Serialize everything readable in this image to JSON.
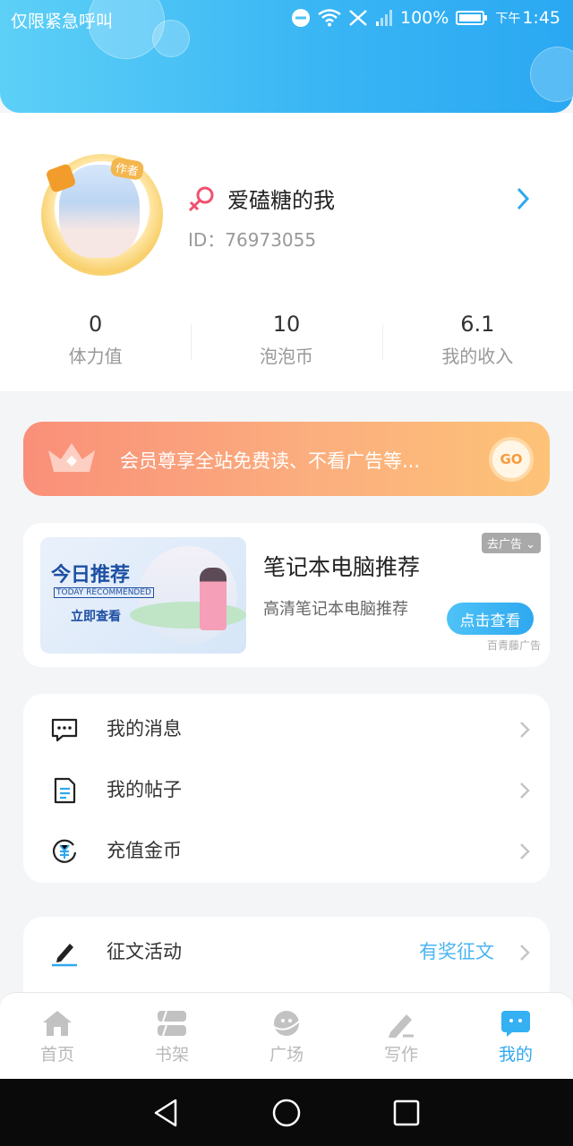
{
  "status_bar": {
    "left_text": "仅限紧急呼叫",
    "battery": "100%",
    "ampm": "下午",
    "time": "1:45"
  },
  "profile": {
    "avatar_tag": "作者",
    "username": "爱磕糖的我",
    "id_label": "ID：76973055",
    "stats": [
      {
        "value": "0",
        "label": "体力值"
      },
      {
        "value": "10",
        "label": "泡泡币"
      },
      {
        "value": "6.1",
        "label": "我的收入"
      }
    ]
  },
  "vip_banner": {
    "text": "会员尊享全站免费读、不看广告等...",
    "go": "GO"
  },
  "ad": {
    "image_title": "今日推荐",
    "image_subtitle": "TODAY RECOMMENDED",
    "image_button": "立即查看",
    "title": "笔记本电脑推荐",
    "description": "高清笔记本电脑推荐",
    "close_label": "去广告",
    "cta": "点击查看",
    "source": "百青藤广告"
  },
  "menu": {
    "items": [
      {
        "label": "我的消息",
        "icon": "chat-icon"
      },
      {
        "label": "我的帖子",
        "icon": "document-icon"
      },
      {
        "label": "充值金币",
        "icon": "coin-icon"
      }
    ],
    "contest": {
      "label": "征文活动",
      "extra": "有奖征文",
      "icon": "pen-icon"
    }
  },
  "tabs": [
    {
      "label": "首页",
      "icon": "home-icon",
      "active": false
    },
    {
      "label": "书架",
      "icon": "bookshelf-icon",
      "active": false
    },
    {
      "label": "广场",
      "icon": "planet-icon",
      "active": false
    },
    {
      "label": "写作",
      "icon": "pen-icon",
      "active": false
    },
    {
      "label": "我的",
      "icon": "profile-bubble-icon",
      "active": true
    }
  ],
  "colors": {
    "accent": "#2ea8f0",
    "vip_start": "#fa8f79",
    "vip_end": "#fdc377"
  }
}
